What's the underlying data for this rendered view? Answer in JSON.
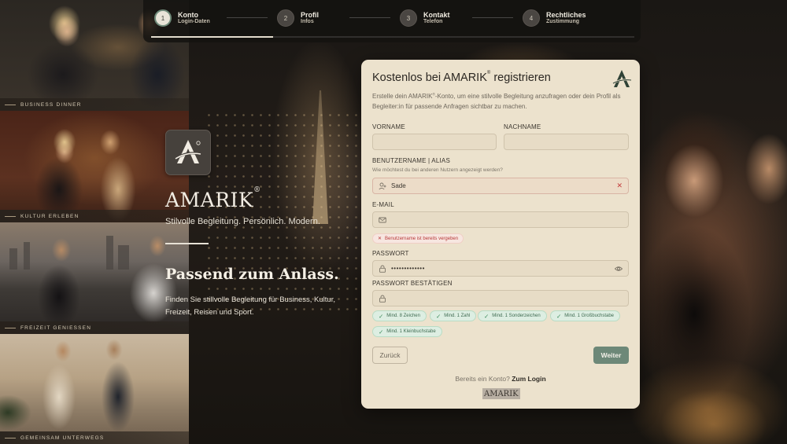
{
  "stepper": {
    "steps": [
      {
        "num": "1",
        "title": "Konto",
        "sub": "Login-Daten"
      },
      {
        "num": "2",
        "title": "Profil",
        "sub": "Infos"
      },
      {
        "num": "3",
        "title": "Kontakt",
        "sub": "Telefon"
      },
      {
        "num": "4",
        "title": "Rechtliches",
        "sub": "Zustimmung"
      }
    ],
    "progress": 0.25
  },
  "gallery": [
    {
      "caption": "BUSINESS DINNER"
    },
    {
      "caption": "KULTUR ERLEBEN"
    },
    {
      "caption": "FREIZEIT GENIESSEN"
    },
    {
      "caption": "GEMEINSAM UNTERWEGS"
    }
  ],
  "brand": {
    "name": "AMARIK",
    "reg": "®",
    "tagline": "Stilvolle Begleitung. Persönlich. Modern.",
    "headline": "Passend zum Anlass.",
    "description": "Finden Sie stillvolle Begleitung für Business, Kultur, Freizeit, Reisen und Sport."
  },
  "form": {
    "title": "Kostenlos bei AMARIK",
    "title_reg": "®",
    "title_suffix": " registrieren",
    "intro_a": "Erstelle dein AMARIK",
    "intro_reg": "®",
    "intro_b": "-Konto, um eine stilvolle Begleitung anzufragen oder dein Profil als Begleiter:in für passende Anfragen sichtbar zu machen.",
    "labels": {
      "firstname": "VORNAME",
      "lastname": "NACHNAME",
      "username": "BENUTZERNAME | ALIAS",
      "username_hint": "Wie möchtest du bei anderen Nutzern angezeigt werden?",
      "email": "E-MAIL",
      "password": "PASSWORT",
      "password_confirm": "PASSWORT BESTÄTIGEN"
    },
    "values": {
      "firstname": "",
      "lastname": "",
      "username": "Sade",
      "email": "",
      "password": "•••••••••••••",
      "password_confirm": ""
    },
    "error": "Benutzername ist bereits vergeben",
    "requirements": [
      "Mind. 8 Zeichen",
      "Mind. 1 Zahl",
      "Mind. 1 Sonderzeichen",
      "Mind. 1 Großbuchstabe",
      "Mind. 1 Kleinbuchstabe"
    ],
    "back_label": "Zurück",
    "next_label": "Weiter",
    "login_prompt": "Bereits ein Konto?",
    "login_link": "Zum Login",
    "footer_logo": "AMARIK"
  },
  "colors": {
    "card_bg": "#ece2cd",
    "accent": "#6d8878",
    "error": "#c43d3d",
    "success": "#3b8a5a"
  },
  "icons": [
    "user-icon",
    "close-icon",
    "mail-icon",
    "lock-icon",
    "eye-icon",
    "check-icon",
    "amarik-logo-icon"
  ]
}
